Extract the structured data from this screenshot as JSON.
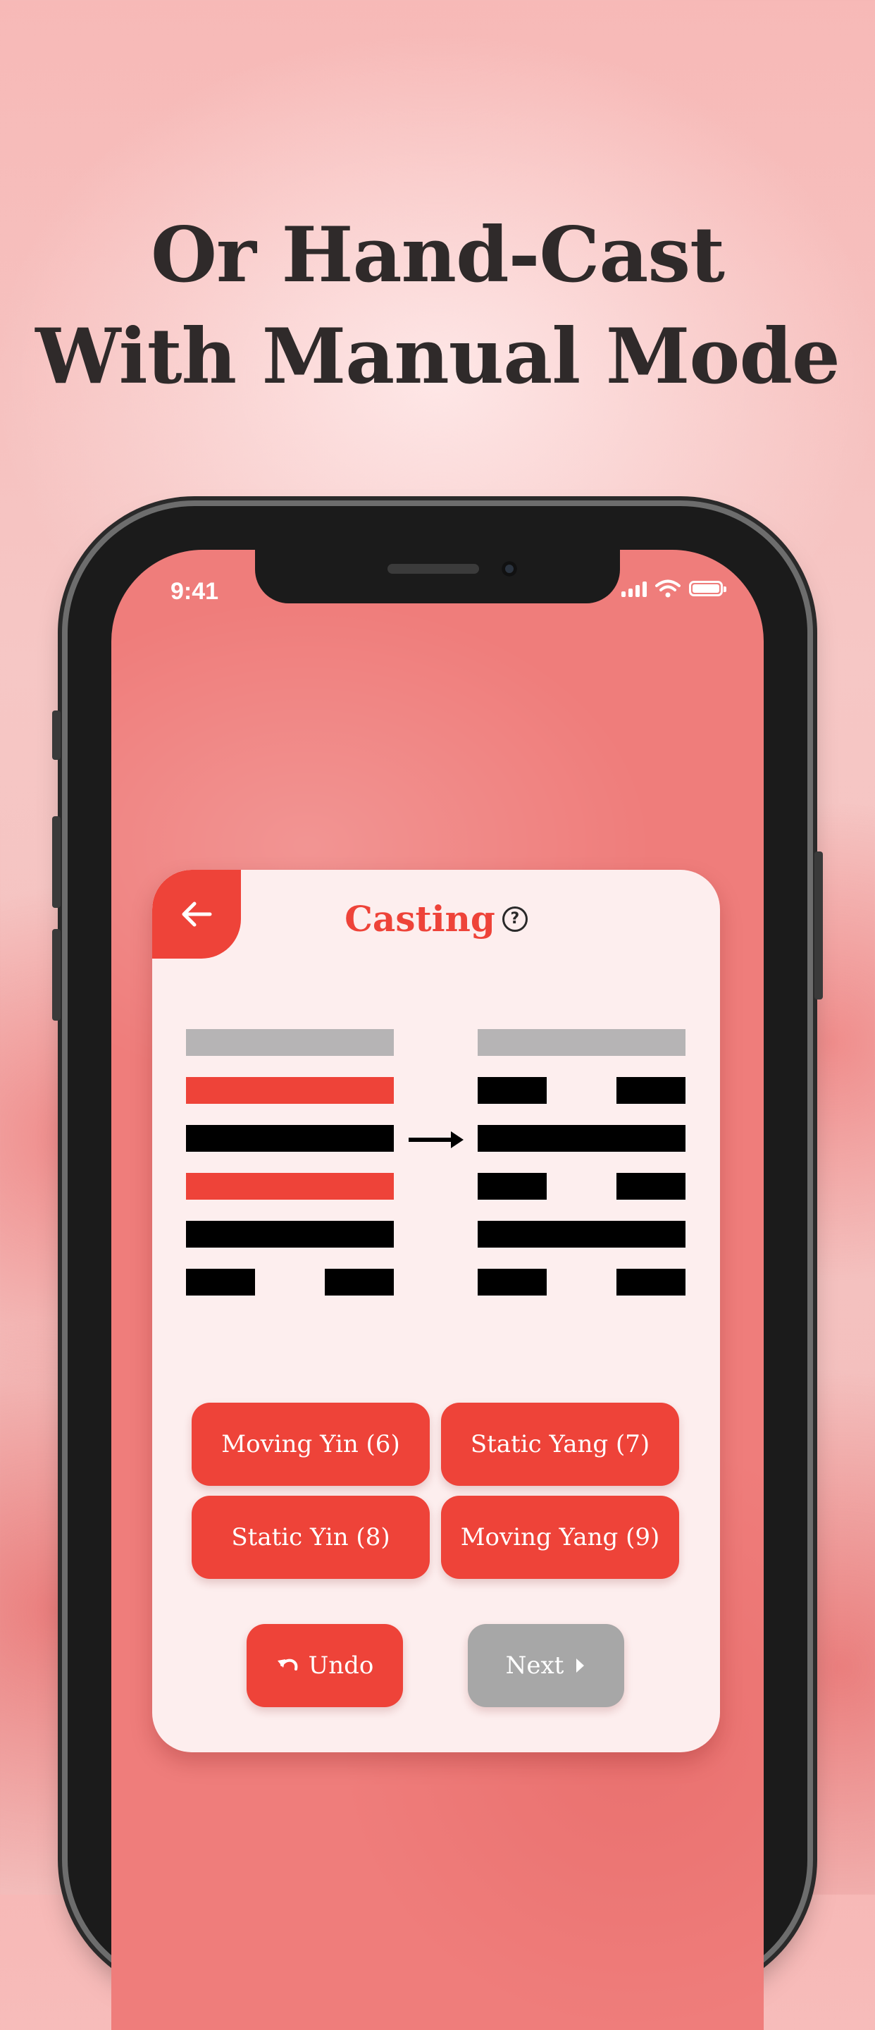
{
  "headline": {
    "line1": "Or Hand-Cast",
    "line2": "With Manual Mode"
  },
  "status_bar": {
    "time": "9:41"
  },
  "casting": {
    "title": "Casting",
    "help_symbol": "?",
    "back_icon": "arrow-left-icon",
    "accent_color": "#ee4339",
    "primary_hexagram": [
      "placeholder",
      "moving-yang",
      "yang",
      "moving-yang",
      "yang",
      "yin"
    ],
    "changed_hexagram": [
      "placeholder",
      "yin",
      "yang",
      "yin",
      "yang",
      "yin"
    ]
  },
  "answers": [
    {
      "label": "Moving Yin (6)"
    },
    {
      "label": "Static Yang (7)"
    },
    {
      "label": "Static Yin (8)"
    },
    {
      "label": "Moving Yang (9)"
    }
  ],
  "actions": {
    "undo_label": "Undo",
    "undo_icon": "undo-icon",
    "next_label": "Next",
    "next_icon": "caret-right-icon",
    "next_color": "#a7a7a7"
  }
}
